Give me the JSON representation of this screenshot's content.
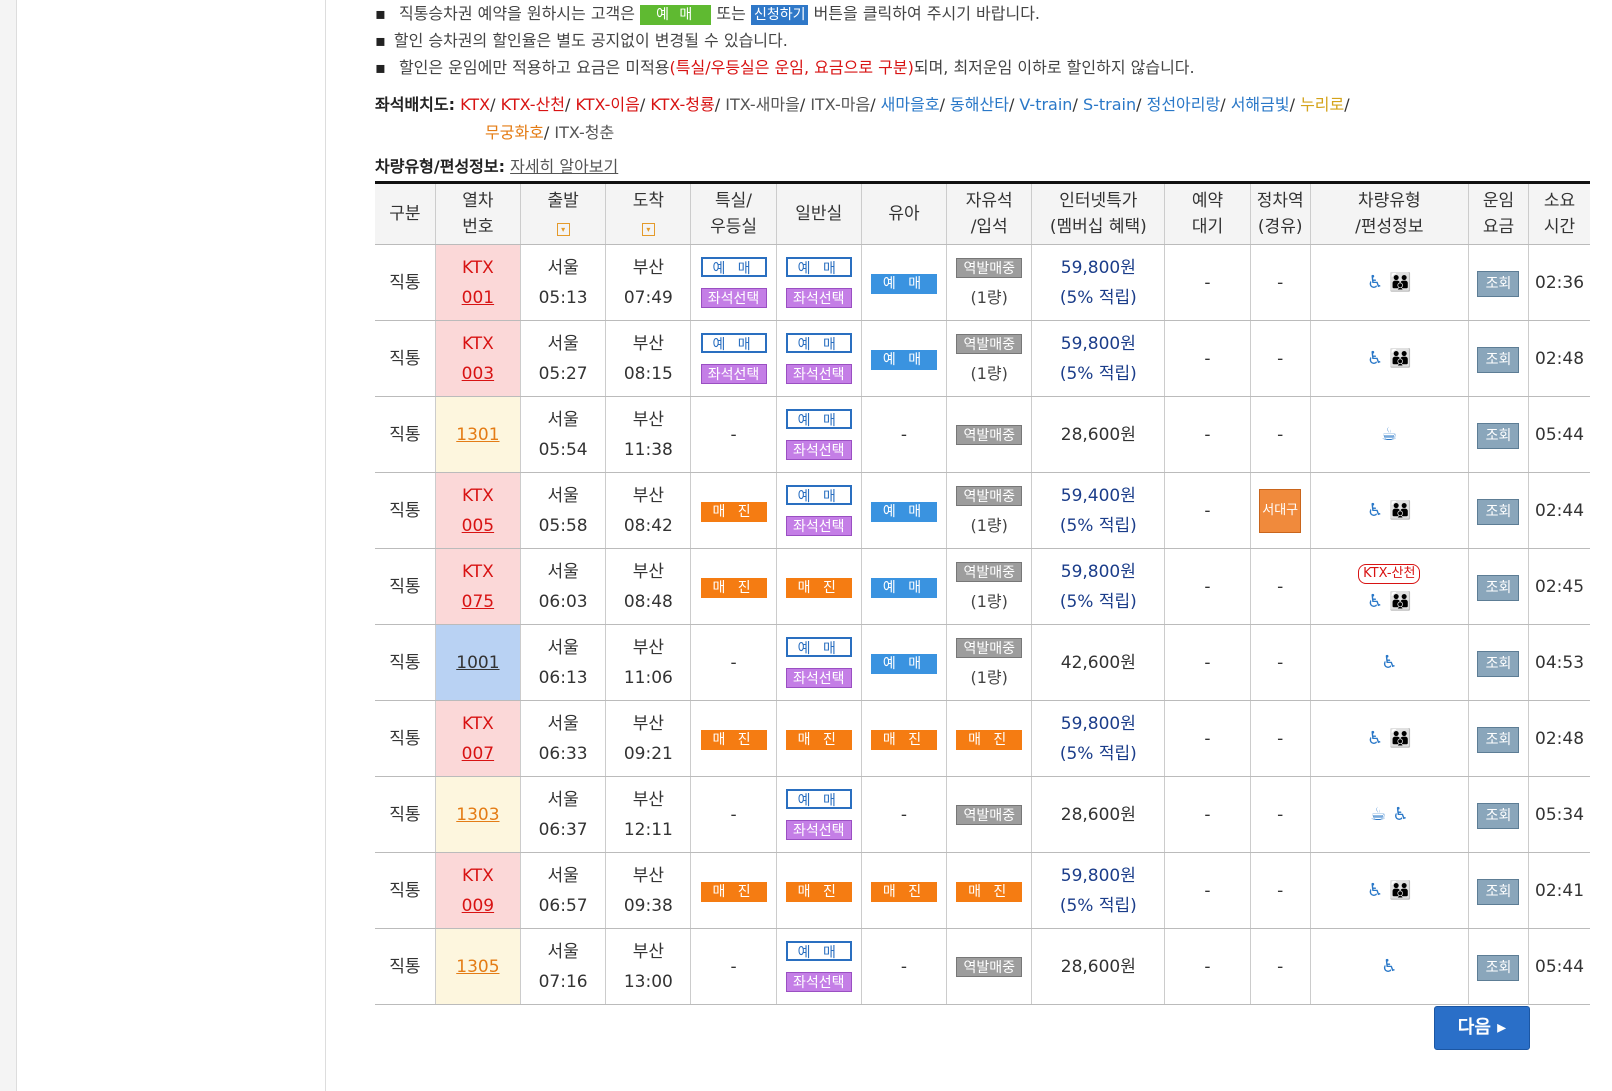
{
  "notice": {
    "line1_pre": "직통승차권 예약을 원하시는 고객은",
    "btn_reserve": "예 매",
    "line1_mid": "또는",
    "btn_apply": "신청하기",
    "line1_post": "버튼을 클릭하여 주시기 바랍니다.",
    "line2": "할인 승차권의 할인율은 별도 공지없이 변경될 수 있습니다.",
    "line3_pre": "할인은 운임에만 적용하고 요금은 미적용",
    "line3_red": "(특실/우등실은 운임, 요금으로 구분)",
    "line3_post": "되며, 최저운임 이하로 할인하지 않습니다."
  },
  "seatmap": {
    "label": "좌석배치도:",
    "items": [
      "KTX",
      "KTX-산천",
      "KTX-이음",
      "KTX-청룡",
      "ITX-새마을",
      "ITX-마음",
      "새마을호",
      "동해산타",
      "V-train",
      "S-train",
      "정선아리랑",
      "서해금빛",
      "누리로",
      "무궁화호",
      "ITX-청춘"
    ]
  },
  "car_info": {
    "label": "차량유형/편성정보:",
    "link": "자세히 알아보기"
  },
  "headers": {
    "type": "구분",
    "train1": "열차",
    "train2": "번호",
    "dep": "출발",
    "arr": "도착",
    "first1": "특실/",
    "first2": "우등실",
    "general": "일반실",
    "child": "유아",
    "free1": "자유석",
    "free2": "/입석",
    "web1": "인터넷특가",
    "web2": "(멤버십 혜택)",
    "wait1": "예약",
    "wait2": "대기",
    "stop1": "정차역",
    "stop2": "(경유)",
    "car1": "차량유형",
    "car2": "/편성정보",
    "fare1": "운임",
    "fare2": "요금",
    "time1": "소요",
    "time2": "시간",
    "sort_mark": "▾"
  },
  "labels": {
    "reserve": "예 매",
    "seat_select": "좌석선택",
    "sold_out": "매 진",
    "station_sale": "역발매중",
    "dash": "-",
    "inquiry": "조회",
    "points": "(5% 적립)",
    "one_car": "(1량)"
  },
  "rows": [
    {
      "type": "직통",
      "line": "KTX",
      "no": "001",
      "dep_st": "서울",
      "dep": "05:13",
      "arr_st": "부산",
      "arr": "07:49",
      "price": "59,800원",
      "duration": "02:36"
    },
    {
      "type": "직통",
      "line": "KTX",
      "no": "003",
      "dep_st": "서울",
      "dep": "05:27",
      "arr_st": "부산",
      "arr": "08:15",
      "price": "59,800원",
      "duration": "02:48"
    },
    {
      "type": "직통",
      "line": "",
      "no": "1301",
      "dep_st": "서울",
      "dep": "05:54",
      "arr_st": "부산",
      "arr": "11:38",
      "price": "28,600원",
      "duration": "05:44"
    },
    {
      "type": "직통",
      "line": "KTX",
      "no": "005",
      "dep_st": "서울",
      "dep": "05:58",
      "arr_st": "부산",
      "arr": "08:42",
      "price": "59,400원",
      "duration": "02:44",
      "stop": "서대구"
    },
    {
      "type": "직통",
      "line": "KTX",
      "no": "075",
      "dep_st": "서울",
      "dep": "06:03",
      "arr_st": "부산",
      "arr": "08:48",
      "price": "59,800원",
      "duration": "02:45",
      "car_badge": "KTX-산천"
    },
    {
      "type": "직통",
      "line": "",
      "no": "1001",
      "dep_st": "서울",
      "dep": "06:13",
      "arr_st": "부산",
      "arr": "11:06",
      "price": "42,600원",
      "duration": "04:53"
    },
    {
      "type": "직통",
      "line": "KTX",
      "no": "007",
      "dep_st": "서울",
      "dep": "06:33",
      "arr_st": "부산",
      "arr": "09:21",
      "price": "59,800원",
      "duration": "02:48"
    },
    {
      "type": "직통",
      "line": "",
      "no": "1303",
      "dep_st": "서울",
      "dep": "06:37",
      "arr_st": "부산",
      "arr": "12:11",
      "price": "28,600원",
      "duration": "05:34"
    },
    {
      "type": "직통",
      "line": "KTX",
      "no": "009",
      "dep_st": "서울",
      "dep": "06:57",
      "arr_st": "부산",
      "arr": "09:38",
      "price": "59,800원",
      "duration": "02:41"
    },
    {
      "type": "직통",
      "line": "",
      "no": "1305",
      "dep_st": "서울",
      "dep": "07:16",
      "arr_st": "부산",
      "arr": "13:00",
      "price": "28,600원",
      "duration": "05:44"
    }
  ],
  "icons": {
    "wheelchair": "wheelchair-icon",
    "family": "family-seat-icon",
    "cafe": "cafe-icon"
  },
  "next_button": "다음 ▸"
}
